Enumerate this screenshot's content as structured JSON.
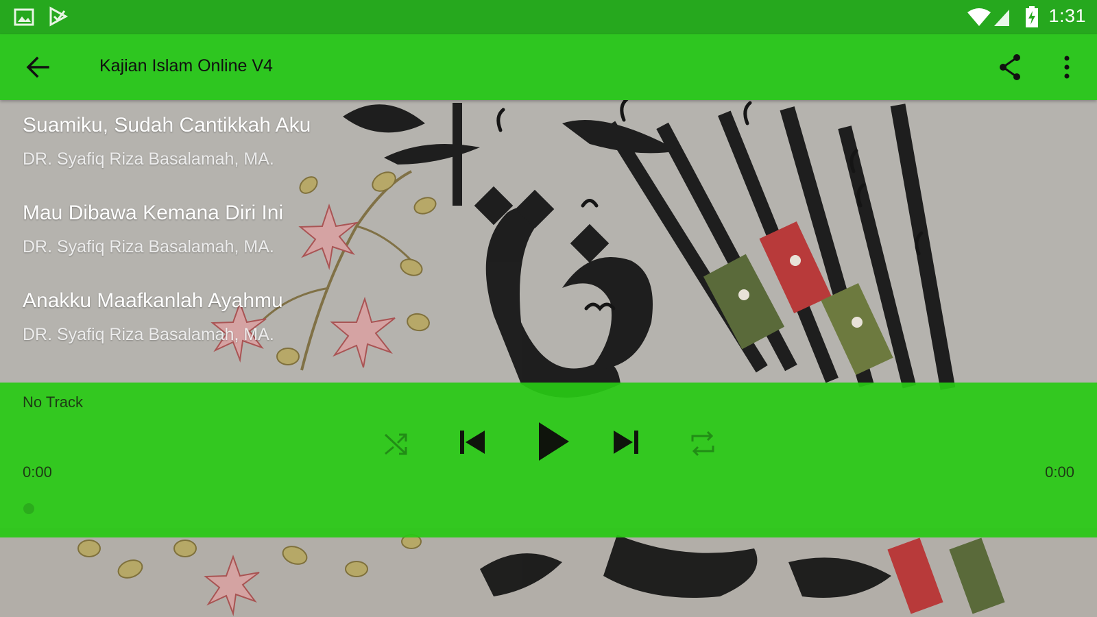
{
  "status_bar": {
    "time": "1:31",
    "left_icons": [
      "image-icon",
      "play-store-icon"
    ],
    "right_icons": [
      "wifi-icon",
      "signal-icon",
      "battery-charging-icon"
    ]
  },
  "app_bar": {
    "title": "Kajian Islam Online V4",
    "back_icon": "arrow-back-icon",
    "share_icon": "share-icon",
    "more_icon": "more-vert-icon"
  },
  "playlist": {
    "items": [
      {
        "title": "Suamiku, Sudah Cantikkah Aku",
        "artist": "DR. Syafiq Riza Basalamah, MA."
      },
      {
        "title": "Mau Dibawa Kemana Diri Ini",
        "artist": "DR. Syafiq Riza Basalamah, MA."
      },
      {
        "title": "Anakku Maafkanlah Ayahmu",
        "artist": "DR. Syafiq Riza Basalamah, MA."
      }
    ]
  },
  "player": {
    "now_playing": "No Track",
    "time_elapsed": "0:00",
    "time_total": "0:00",
    "progress": 0,
    "controls": [
      "shuffle-icon",
      "skip-previous-icon",
      "play-icon",
      "skip-next-icon",
      "repeat-icon"
    ]
  },
  "colors": {
    "status_bar": "#26a81e",
    "app_bar": "#2ec620",
    "player_panel": "#28c814",
    "text_primary": "#ffffff"
  }
}
